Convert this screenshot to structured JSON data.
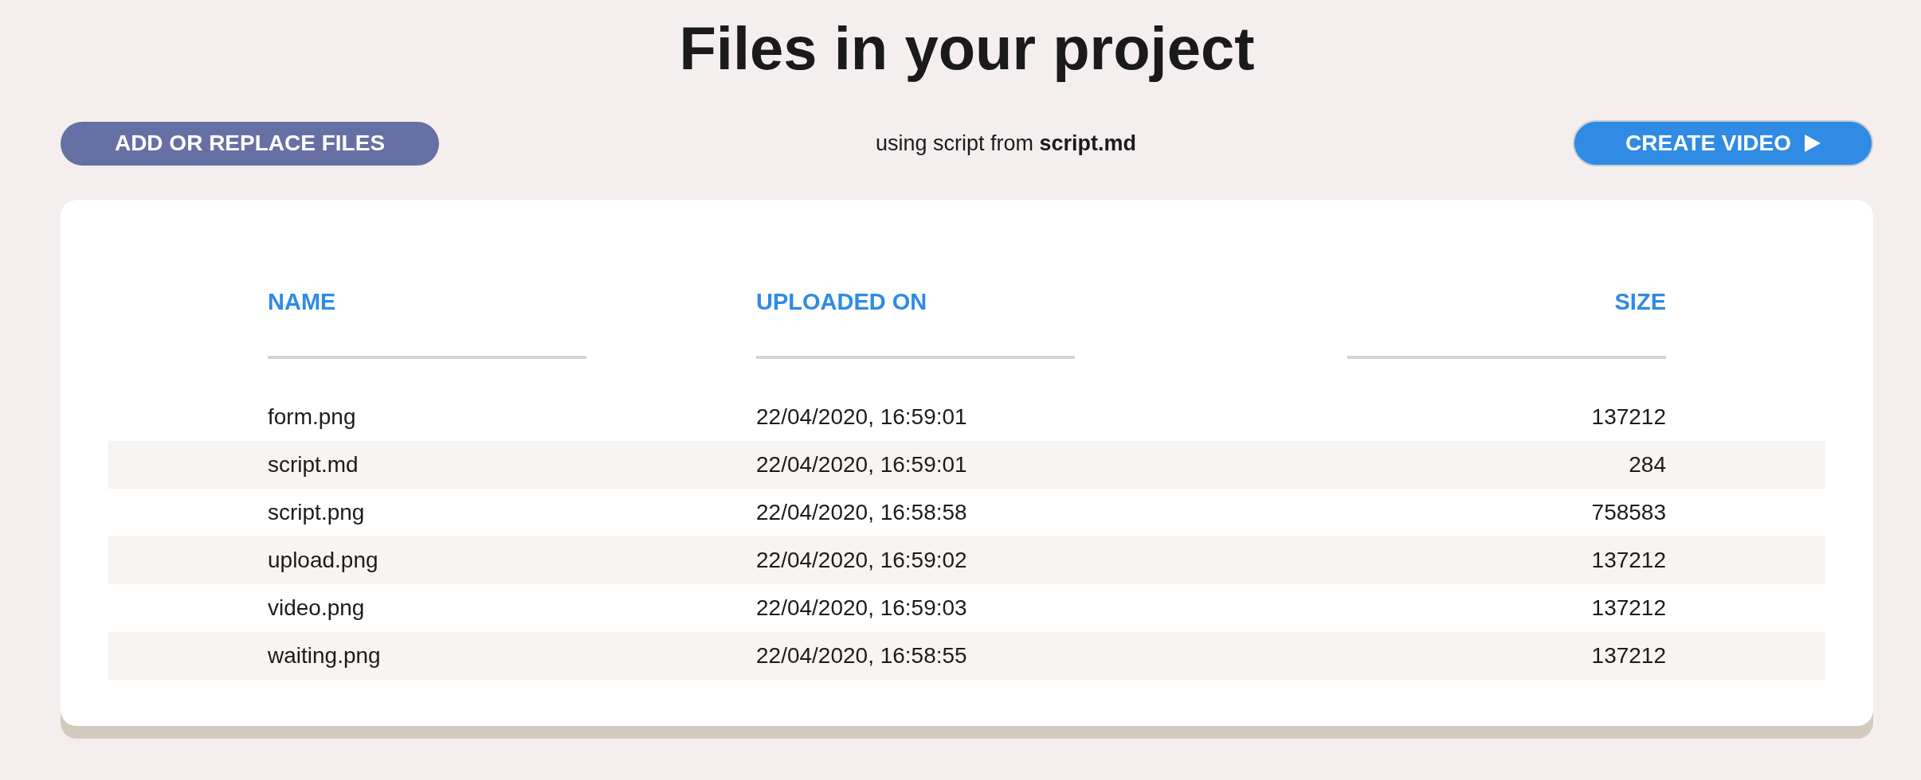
{
  "page": {
    "title": "Files in your project"
  },
  "toolbar": {
    "upload_button": "ADD OR REPLACE FILES",
    "source_note": "using script from **script.md**",
    "create_button": "CREATE VIDEO"
  },
  "table": {
    "columns": [
      {
        "label": "NAME"
      },
      {
        "label": "UPLOADED ON"
      },
      {
        "label": "SIZE"
      }
    ],
    "rows": [
      {
        "name": "form.png",
        "uploaded_on": "22/04/2020, 16:59:01",
        "size": "137212"
      },
      {
        "name": "script.md",
        "uploaded_on": "22/04/2020, 16:59:01",
        "size": "284"
      },
      {
        "name": "script.png",
        "uploaded_on": "22/04/2020, 16:58:58",
        "size": "758583"
      },
      {
        "name": "upload.png",
        "uploaded_on": "22/04/2020, 16:59:02",
        "size": "137212"
      },
      {
        "name": "video.png",
        "uploaded_on": "22/04/2020, 16:59:03",
        "size": "137212"
      },
      {
        "name": "waiting.png",
        "uploaded_on": "22/04/2020, 16:58:55",
        "size": "137212"
      }
    ]
  }
}
